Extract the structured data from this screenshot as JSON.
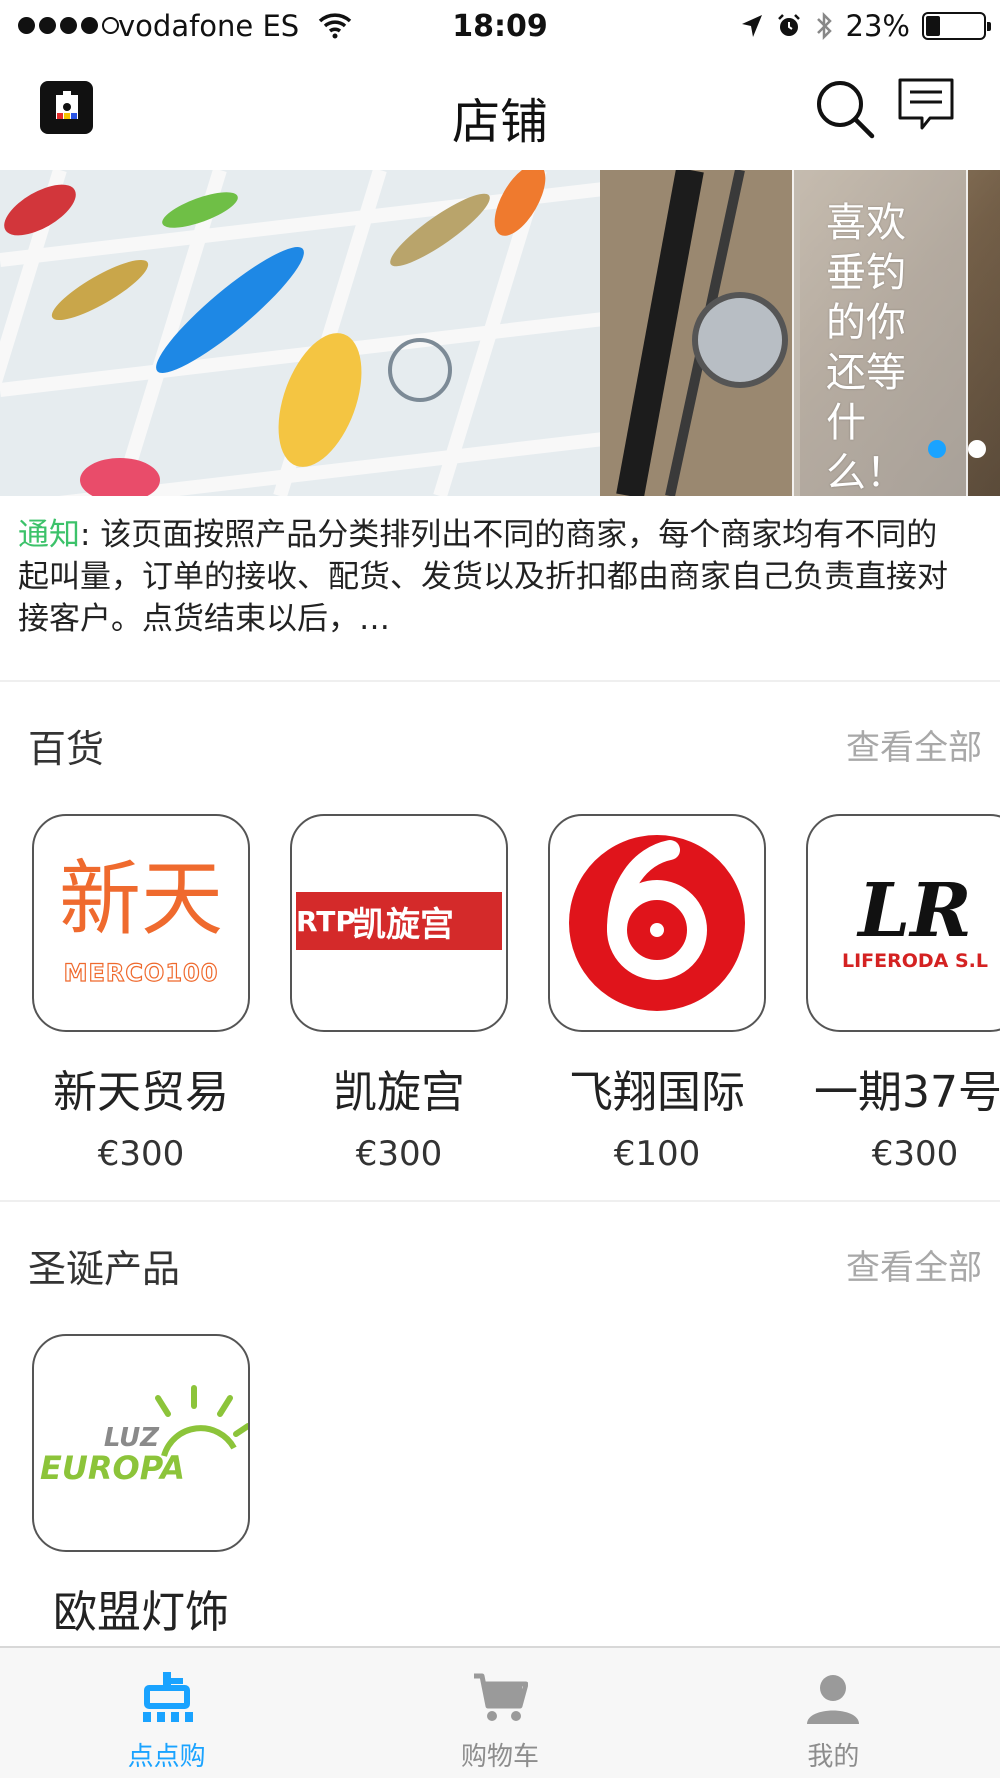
{
  "status_bar": {
    "carrier": "vodafone ES",
    "time": "18:09",
    "battery": "23%",
    "battery_level": 0.23
  },
  "nav": {
    "title": "店铺",
    "search_icon": "search-icon",
    "message_icon": "message-icon"
  },
  "banner": {
    "text": "喜欢垂钓的你还等什么！",
    "slides": 2,
    "active_slide": 0
  },
  "notice": {
    "label": "通知",
    "text": ": 该页面按照产品分类排列出不同的商家，每个商家均有不同的起叫量，订单的接收、配货、发货以及折扣都由商家自己负责直接对接客户。点货结束以后，…"
  },
  "sections": [
    {
      "title": "百货",
      "view_all": "查看全部",
      "stores": [
        {
          "name": "新天贸易",
          "min_order": "€300",
          "logo_text": "新天",
          "logo_sub": "MERCO100"
        },
        {
          "name": "凯旋宫",
          "min_order": "€300",
          "logo_text": "凯旋宫",
          "logo_sub": "RTP"
        },
        {
          "name": "飞翔国际",
          "min_order": "€100"
        },
        {
          "name": "一期37号",
          "min_order": "€300",
          "logo_text": "LR",
          "logo_sub": "LIFERODA S.L"
        }
      ]
    },
    {
      "title": "圣诞产品",
      "view_all": "查看全部",
      "stores": [
        {
          "name": "欧盟灯饰",
          "logo_text": "LUZ",
          "logo_sub": "EUROPA"
        }
      ]
    }
  ],
  "tabs": [
    {
      "label": "点点购",
      "icon": "dian-icon",
      "active": true
    },
    {
      "label": "购物车",
      "icon": "cart-icon",
      "active": false
    },
    {
      "label": "我的",
      "icon": "user-icon",
      "active": false
    }
  ],
  "colors": {
    "accent": "#1aa3ff",
    "notice_label": "#3cc26a",
    "view_all": "#a8a8a8"
  }
}
